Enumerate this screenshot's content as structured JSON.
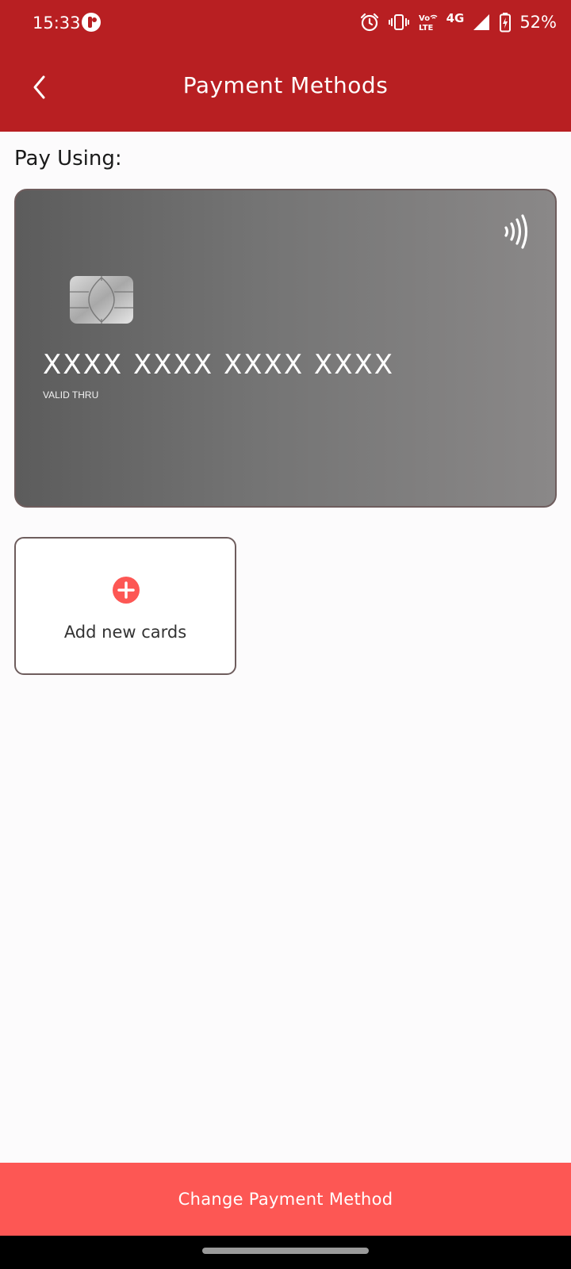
{
  "status_bar": {
    "time": "15:33",
    "network": "4G",
    "volte": "Vo LTE",
    "battery": "52%"
  },
  "header": {
    "title": "Payment Methods"
  },
  "section": {
    "label": "Pay Using:"
  },
  "card": {
    "number": "XXXX XXXX XXXX XXXX",
    "valid_thru_label": "VALID THRU"
  },
  "add_card": {
    "label": "Add new cards"
  },
  "footer": {
    "button_label": "Change Payment Method"
  },
  "colors": {
    "app_bar": "#b81f22",
    "accent": "#fd5754",
    "card_border": "#6e5d5d",
    "background": "#fcfbfc"
  },
  "icons": {
    "back": "chevron-left-icon",
    "contactless": "contactless-icon",
    "chip": "card-chip-icon",
    "add": "plus-circle-icon"
  }
}
